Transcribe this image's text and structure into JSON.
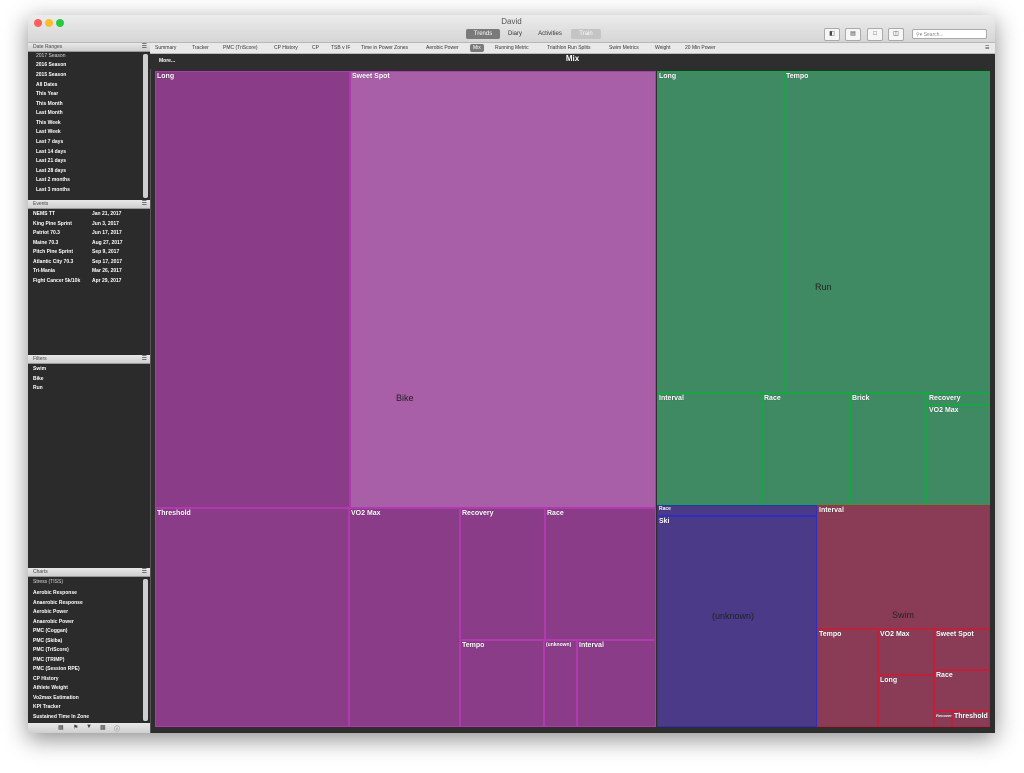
{
  "window": {
    "title": "David"
  },
  "toolbar": {
    "views": [
      "Trends",
      "Diary",
      "Activities",
      "Train"
    ],
    "search_placeholder": "Search..."
  },
  "sidebar": {
    "date_ranges": {
      "header": "Date Ranges",
      "items": [
        "2017 Season",
        "2016 Season",
        "2015 Season",
        "All Dates",
        "This Year",
        "This Month",
        "Last Month",
        "This Week",
        "Last Week",
        "Last 7 days",
        "Last 14 days",
        "Last 21 days",
        "Last 28 days",
        "Last 2 months",
        "Last 3 months"
      ]
    },
    "events": {
      "header": "Events",
      "items": [
        {
          "name": "NEMS TT",
          "date": "Jan 21, 2017"
        },
        {
          "name": "King Pine Sprint",
          "date": "Jun 3, 2017"
        },
        {
          "name": "Patriot 70.3",
          "date": "Jun 17, 2017"
        },
        {
          "name": "Maine 70.3",
          "date": "Aug 27, 2017"
        },
        {
          "name": "Pitch Pine Sprint",
          "date": "Sep 9, 2017"
        },
        {
          "name": "Atlantic City 70.3",
          "date": "Sep 17, 2017"
        },
        {
          "name": "Tri-Mania",
          "date": "Mar 26, 2017"
        },
        {
          "name": "Fight Cancer 5k/10k",
          "date": "Apr 29, 2017"
        }
      ]
    },
    "filters": {
      "header": "Filters",
      "items": [
        "Swim",
        "Bike",
        "Run"
      ]
    },
    "charts": {
      "header": "Charts",
      "selected": "Stress (TISS)",
      "items": [
        "Aerobic Response",
        "Anaerobic Response",
        "Aerobic Power",
        "Anaerobic Power",
        "PMC (Coggan)",
        "PMC (Skiba)",
        "PMC (TriScore)",
        "PMC (TRIMP)",
        "PMC (Session RPE)",
        "CP History",
        "Athlete Weight",
        "Vo2max Estimation",
        "KPI Tracker",
        "Sustained Time In Zone"
      ]
    }
  },
  "tabs": [
    "Summary",
    "Tracker",
    "PMC (TriScore)",
    "CP History",
    "CP",
    "TSB v IF",
    "Time in Power Zones",
    "Aerobic Power",
    "Mix",
    "Running Metric",
    "Triathlon Run Splits",
    "Swim Metrics",
    "Weight",
    "20 Min Power"
  ],
  "active_tab": "Mix",
  "chart": {
    "title": "Mix",
    "more": "More..."
  },
  "treemap": {
    "groups": {
      "bike": "Bike",
      "run": "Run",
      "unknown": "(unknown)",
      "swim": "Swim"
    },
    "cells": {
      "bike_long": "Long",
      "bike_sweet": "Sweet Spot",
      "bike_threshold": "Threshold",
      "bike_vo2": "VO2 Max",
      "bike_recovery": "Recovery",
      "bike_race": "Race",
      "bike_tempo": "Tempo",
      "bike_unknown": "(unknown)",
      "bike_interval": "Interval",
      "run_long": "Long",
      "run_tempo": "Tempo",
      "run_interval": "Interval",
      "run_race": "Race",
      "run_brick": "Brick",
      "run_recovery": "Recovery",
      "run_vo2": "VO2 Max",
      "unk_race": "Race",
      "unk_ski": "Ski",
      "swim_interval": "Interval",
      "swim_tempo": "Tempo",
      "swim_vo2": "VO2 Max",
      "swim_sweet": "Sweet Spot",
      "swim_long": "Long",
      "swim_race": "Race",
      "swim_recovery": "Recovery",
      "swim_threshold": "Threshold"
    }
  },
  "colors": {
    "bike": "#a95ea8",
    "bike_dark": "#8a3c88",
    "run": "#3f8a63",
    "unknown": "#4a3a88",
    "swim": "#8a3c56"
  }
}
